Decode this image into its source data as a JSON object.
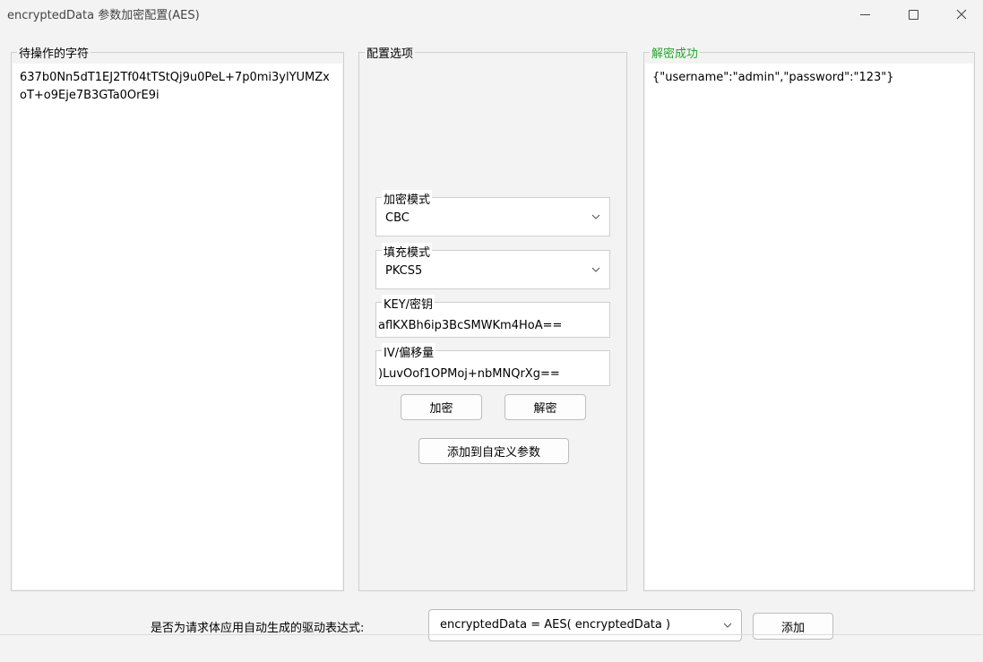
{
  "window": {
    "title": "encryptedData 参数加密配置(AES)"
  },
  "left_panel": {
    "label": "待操作的字符",
    "content": "637b0Nn5dT1EJ2Tf04tTStQj9u0PeL+7p0mi3ylYUMZxoT+o9Eje7B3GTa0OrE9i"
  },
  "middle_panel": {
    "label": "配置选项",
    "mode": {
      "label": "加密模式",
      "value": "CBC"
    },
    "padding": {
      "label": "填充模式",
      "value": "PKCS5"
    },
    "key": {
      "label": "KEY/密钥",
      "value": "aflKXBh6ip3BcSMWKm4HoA=="
    },
    "iv": {
      "label": "IV/偏移量",
      "value": ")LuvOof1OPMoj+nbMNQrXg=="
    },
    "encrypt_label": "加密",
    "decrypt_label": "解密",
    "add_custom_label": "添加到自定义参数"
  },
  "right_panel": {
    "label": "解密成功",
    "label_color": "#22a82a",
    "content": "{\"username\":\"admin\",\"password\":\"123\"}"
  },
  "bottom": {
    "label": "是否为请求体应用自动生成的驱动表达式:",
    "expression": "encryptedData = AES( encryptedData )",
    "add_label": "添加"
  },
  "icons": {
    "minimize": "minimize-icon",
    "maximize": "maximize-icon",
    "close": "close-icon",
    "dropdown": "chevron-down-icon"
  }
}
